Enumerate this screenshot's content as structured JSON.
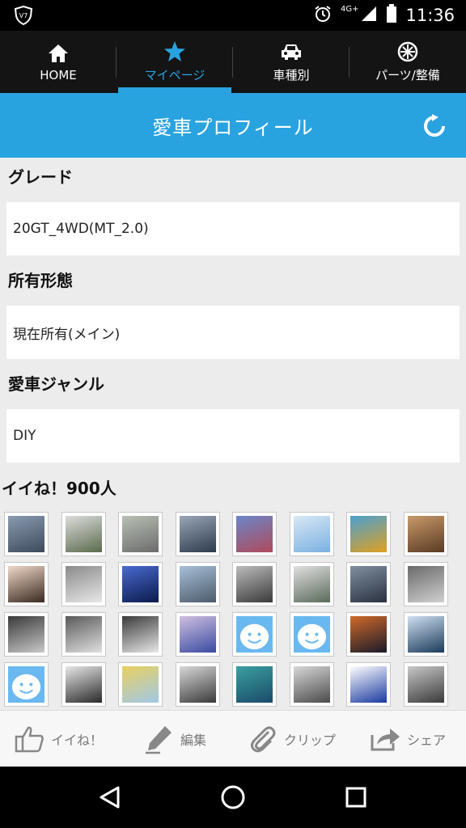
{
  "status_bar": {
    "time": "11:36",
    "network": "4G+"
  },
  "nav": {
    "tabs": [
      {
        "label": "HOME",
        "icon": "home-icon",
        "active": false
      },
      {
        "label": "マイページ",
        "icon": "star-icon",
        "active": true
      },
      {
        "label": "車種別",
        "icon": "car-icon",
        "active": false
      },
      {
        "label": "パーツ/整備",
        "icon": "wheel-icon",
        "active": false
      }
    ]
  },
  "header": {
    "title": "愛車プロフィール",
    "refresh_icon": "refresh-icon"
  },
  "profile": {
    "grade_label": "グレード",
    "grade_value": "20GT_4WD(MT_2.0)",
    "ownership_label": "所有形態",
    "ownership_value": "現在所有(メイン)",
    "genre_label": "愛車ジャンル",
    "genre_value": "DIY"
  },
  "likes": {
    "label": "イイね！900人",
    "thumbnails": [
      {
        "kind": "photo",
        "colors": [
          "#3d4a5c",
          "#8a9bb0"
        ]
      },
      {
        "kind": "photo",
        "colors": [
          "#5a6b4c",
          "#dcdcdc"
        ]
      },
      {
        "kind": "photo",
        "colors": [
          "#6b6b6b",
          "#b8c0b4"
        ]
      },
      {
        "kind": "photo",
        "colors": [
          "#2c3a4d",
          "#9aa6b6"
        ]
      },
      {
        "kind": "photo",
        "colors": [
          "#b04a5a",
          "#6a86c8"
        ]
      },
      {
        "kind": "photo",
        "colors": [
          "#7ab0e0",
          "#d8e8f4"
        ]
      },
      {
        "kind": "photo",
        "colors": [
          "#e0a020",
          "#4aa0d0"
        ]
      },
      {
        "kind": "photo",
        "colors": [
          "#5a3a24",
          "#c89a6a"
        ]
      },
      {
        "kind": "photo",
        "colors": [
          "#3a2a20",
          "#f0d8c8"
        ]
      },
      {
        "kind": "photo",
        "colors": [
          "#e8e8e8",
          "#8a8a8a"
        ]
      },
      {
        "kind": "photo",
        "colors": [
          "#0a1a4a",
          "#4a6ad0"
        ]
      },
      {
        "kind": "photo",
        "colors": [
          "#4a5a6a",
          "#a8c0d8"
        ]
      },
      {
        "kind": "photo",
        "colors": [
          "#3a3a3a",
          "#bcbcbc"
        ]
      },
      {
        "kind": "photo",
        "colors": [
          "#5a6a5a",
          "#e0e0e0"
        ]
      },
      {
        "kind": "photo",
        "colors": [
          "#2a3040",
          "#8090a0"
        ]
      },
      {
        "kind": "photo",
        "colors": [
          "#d0d0d0",
          "#6a6a6a"
        ]
      },
      {
        "kind": "photo",
        "colors": [
          "#c8c8c8",
          "#3a3a3a"
        ]
      },
      {
        "kind": "photo",
        "colors": [
          "#e0e0e0",
          "#5a5a5a"
        ]
      },
      {
        "kind": "photo",
        "colors": [
          "#e8e8e8",
          "#3a3a3a"
        ]
      },
      {
        "kind": "photo",
        "colors": [
          "#3a4aa0",
          "#d0c0e0"
        ]
      },
      {
        "kind": "avatar",
        "colors": [
          "#6ab8f0",
          "#ffffff"
        ]
      },
      {
        "kind": "avatar",
        "colors": [
          "#6ab8f0",
          "#ffffff"
        ]
      },
      {
        "kind": "photo",
        "colors": [
          "#1a1a2a",
          "#d06a2a"
        ]
      },
      {
        "kind": "photo",
        "colors": [
          "#1a3a5a",
          "#d0e0f0"
        ]
      },
      {
        "kind": "avatar",
        "colors": [
          "#6ab8f0",
          "#ffffff"
        ]
      },
      {
        "kind": "photo",
        "colors": [
          "#2a2a2a",
          "#e8e8e8"
        ]
      },
      {
        "kind": "photo",
        "colors": [
          "#a0c8e8",
          "#e8d060"
        ]
      },
      {
        "kind": "photo",
        "colors": [
          "#3a3a3a",
          "#d8d8d8"
        ]
      },
      {
        "kind": "photo",
        "colors": [
          "#1a4a6a",
          "#3aa0a0"
        ]
      },
      {
        "kind": "photo",
        "colors": [
          "#4a4a4a",
          "#d8d8d8"
        ]
      },
      {
        "kind": "photo",
        "colors": [
          "#1a3aa0",
          "#ffffff"
        ]
      },
      {
        "kind": "photo",
        "colors": [
          "#3a3a3a",
          "#c8c8c8"
        ]
      }
    ]
  },
  "toolbar": {
    "like_label": "イイね！",
    "edit_label": "編集",
    "clip_label": "クリップ",
    "share_label": "シェア"
  },
  "colors": {
    "accent": "#29a3e0",
    "nav_bg": "#141414",
    "page_bg": "#ececec"
  }
}
